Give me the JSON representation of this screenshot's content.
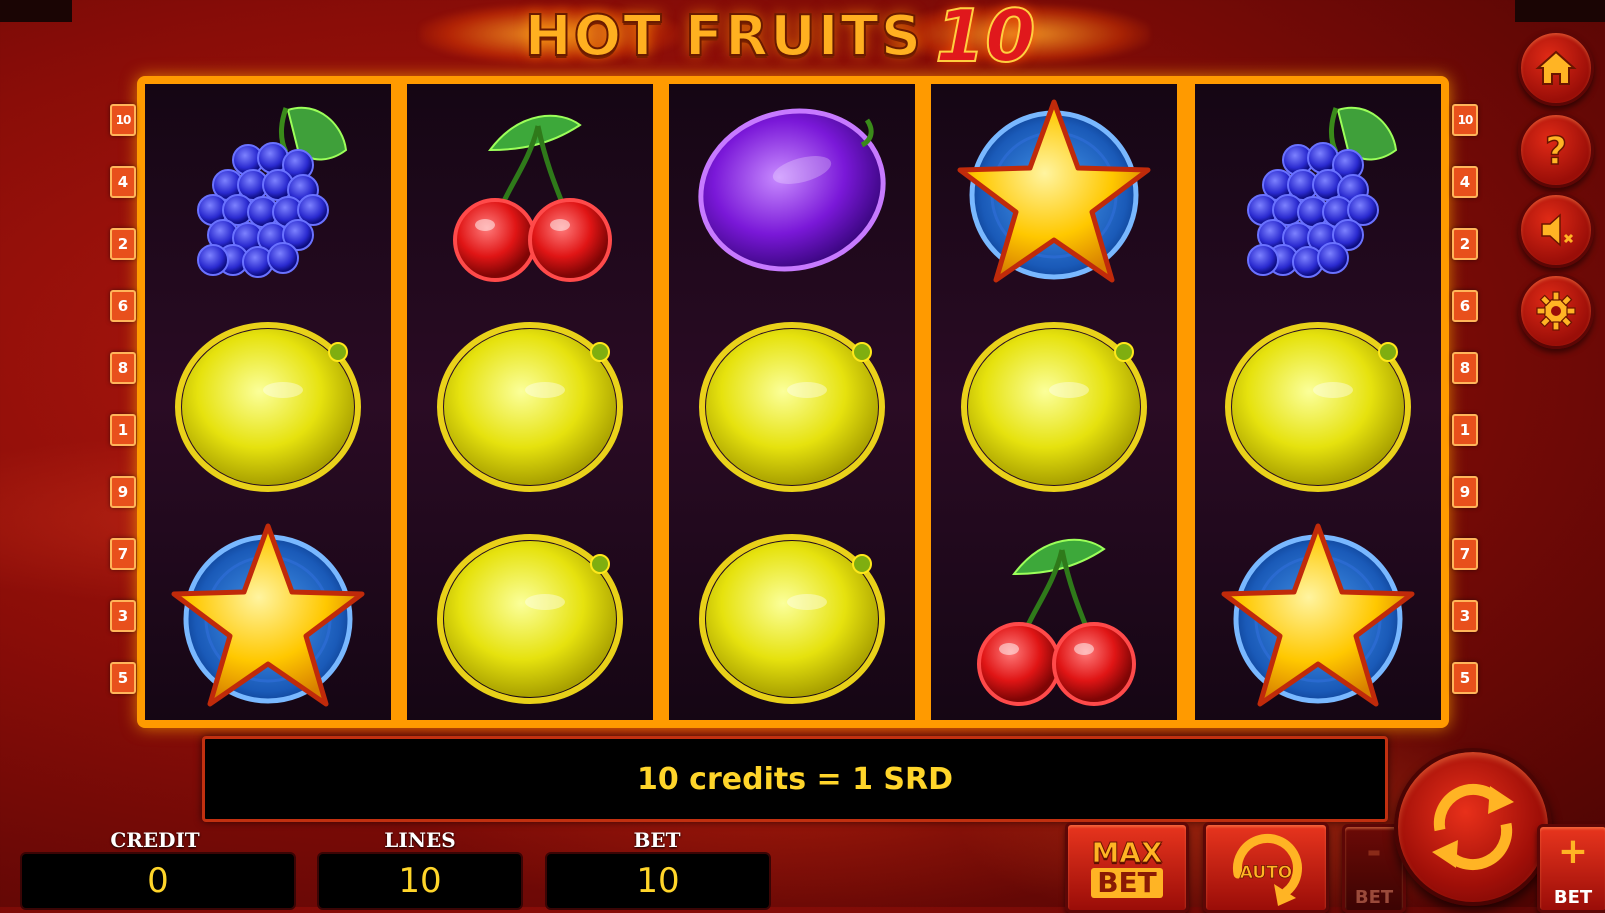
{
  "title": {
    "main": "HOT FRUITS",
    "number": "10"
  },
  "reels": [
    [
      "grapes",
      "lemon",
      "star"
    ],
    [
      "cherry",
      "lemon",
      "lemon"
    ],
    [
      "plum",
      "lemon",
      "lemon"
    ],
    [
      "star",
      "lemon",
      "cherry"
    ],
    [
      "grapes",
      "lemon",
      "star"
    ]
  ],
  "paylines": {
    "left": [
      "10",
      "4",
      "2",
      "6",
      "8",
      "1",
      "9",
      "7",
      "3",
      "5"
    ],
    "right": [
      "10",
      "4",
      "2",
      "6",
      "8",
      "1",
      "9",
      "7",
      "3",
      "5"
    ]
  },
  "side_buttons": [
    "home-icon",
    "help-icon",
    "sound-off-icon",
    "settings-icon"
  ],
  "info": {
    "message": "10 credits = 1 SRD"
  },
  "fields": {
    "credit": {
      "label": "CREDIT",
      "value": "0"
    },
    "lines": {
      "label": "LINES",
      "value": "10"
    },
    "bet": {
      "label": "BET",
      "value": "10"
    }
  },
  "buttons": {
    "max_bet_top": "MAX",
    "max_bet_bottom": "BET",
    "auto": "AUTO",
    "minus_sign": "-",
    "minus_label": "BET",
    "plus_sign": "+",
    "plus_label": "BET"
  },
  "colors": {
    "frame": "#ff9a00",
    "info_text": "#ffd52a",
    "button_red": "#c8200f"
  }
}
